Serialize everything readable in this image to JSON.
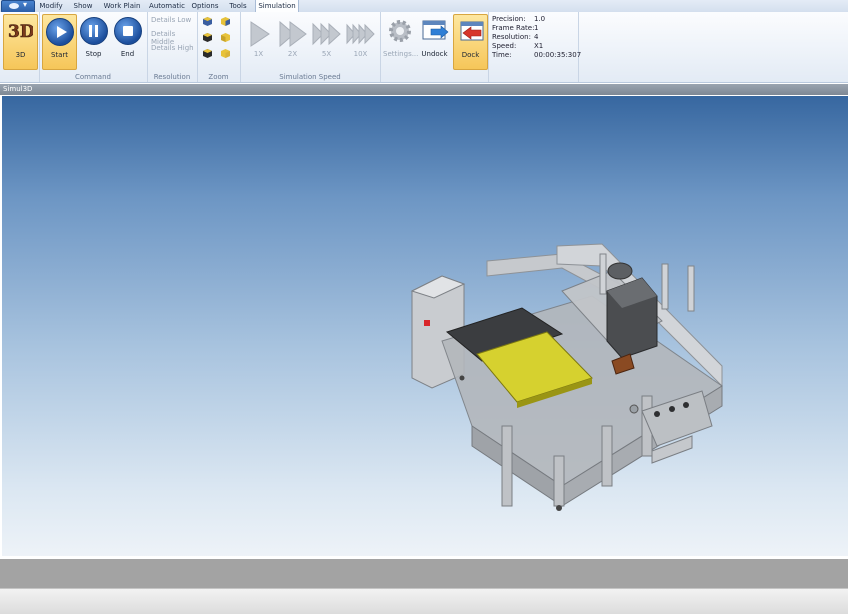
{
  "menu_tabs": [
    "Modify",
    "Show",
    "Work Plain",
    "Automatic",
    "Options",
    "Tools",
    "Simulation"
  ],
  "active_tab": "Simulation",
  "ribbon": {
    "btn_3d": "3D",
    "command": {
      "start": "Start",
      "stop": "Stop",
      "end": "End",
      "label": "Command"
    },
    "resolution": {
      "low": "Details Low",
      "middle": "Details Middle",
      "high": "Details High",
      "label": "Resolution"
    },
    "zoom": {
      "label": "Zoom"
    },
    "speed": {
      "x1": "1X",
      "x2": "2X",
      "x5": "5X",
      "x10": "10X",
      "label": "Simulation Speed"
    },
    "settings": "Settings...",
    "undock": "Undock",
    "dock": "Dock"
  },
  "info": {
    "precision_label": "Precision:",
    "precision_value": "1.0",
    "framerate_label": "Frame Rate:",
    "framerate_value": "1",
    "resolution_label": "Resolution:",
    "resolution_value": "4",
    "speed_label": "Speed:",
    "speed_value": "X1",
    "time_label": "Time:",
    "time_value": "00:00:35:307"
  },
  "pane_title": "Simul3D",
  "colors": {
    "accent": "#2c5fa8",
    "pressed": "#f6c659",
    "pcb": "#d6d12f",
    "machine": "#b9bcc0"
  }
}
